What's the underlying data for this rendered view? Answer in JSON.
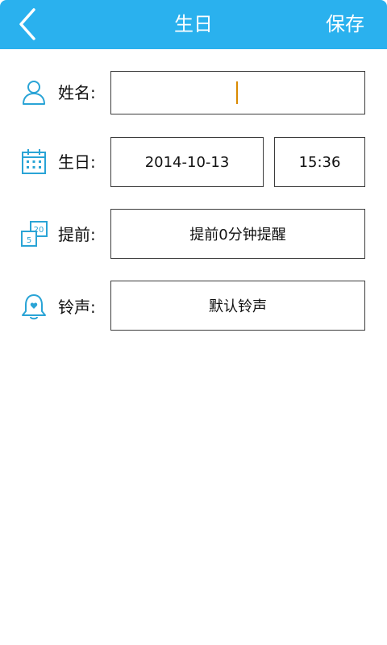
{
  "header": {
    "title": "生日",
    "save_label": "保存",
    "back_icon": "chevron-left-icon"
  },
  "form": {
    "name": {
      "label": "姓名:",
      "value": "",
      "icon": "user-icon"
    },
    "birthday": {
      "label": "生日:",
      "date": "2014-10-13",
      "time": "15:36",
      "icon": "calendar-icon"
    },
    "advance": {
      "label": "提前:",
      "value": "提前0分钟提醒",
      "icon": "reminder-icon",
      "icon_text_top": "20",
      "icon_text_bottom": "5"
    },
    "ringtone": {
      "label": "铃声:",
      "value": "默认铃声",
      "icon": "bell-icon"
    }
  },
  "colors": {
    "accent": "#2ab1ee",
    "icon": "#2aa4d6",
    "caret": "#d98a00"
  }
}
